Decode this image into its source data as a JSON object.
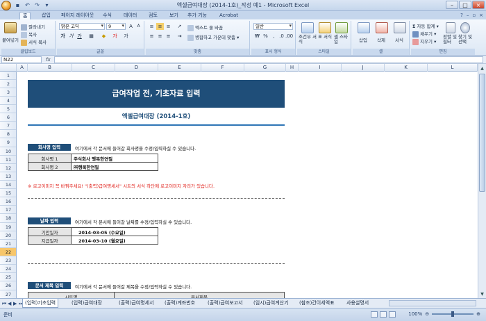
{
  "window": {
    "title": "엑셀급여대장 (2014-1호)_작성 예1 - Microsoft Excel",
    "controls": [
      "–",
      "□",
      "×"
    ]
  },
  "ribbon": {
    "tabs": [
      "홈",
      "삽입",
      "페이지 레이아웃",
      "수식",
      "데이터",
      "검토",
      "보기",
      "추가 기능",
      "Acrobat"
    ],
    "clipboard": {
      "paste": "붙여넣기",
      "cut": "잘라내기",
      "copy": "복사",
      "format_painter": "서식 복사",
      "label": "클립보드"
    },
    "font": {
      "name": "맑은 고딕",
      "size": "9",
      "label": "글꼴"
    },
    "alignment": {
      "wrap": "텍스트 줄 바꿈",
      "merge": "병합하고 가운데 맞춤",
      "label": "맞춤"
    },
    "number": {
      "format": "일반",
      "label": "표시 형식"
    },
    "styles": {
      "conditional": "조건부 서식",
      "table": "표 서식",
      "cell": "셀 스타일",
      "label": "스타일"
    },
    "cells": {
      "insert": "삽입",
      "delete": "삭제",
      "format": "서식",
      "label": "셀"
    },
    "editing": {
      "autosum": "자동 합계",
      "fill": "채우기",
      "clear": "지우기",
      "sort": "정렬 및 필터",
      "find": "찾기 및 선택",
      "label": "편집"
    }
  },
  "formula_bar": {
    "name_box": "N22",
    "fx": "fx",
    "content": ""
  },
  "columns": [
    "A",
    "B",
    "C",
    "D",
    "E",
    "F",
    "G",
    "H",
    "I",
    "J",
    "K",
    "L"
  ],
  "rows": [
    "1",
    "2",
    "3",
    "4",
    "5",
    "6",
    "7",
    "8",
    "9",
    "10",
    "11",
    "12",
    "13",
    "14",
    "15",
    "16",
    "17",
    "18",
    "19",
    "20",
    "21",
    "22",
    "23",
    "24",
    "25",
    "26",
    "27"
  ],
  "selected_row": "22",
  "sheet": {
    "banner": "급여작업 전, 기초자료 입력",
    "subtitle": "엑셀급여대장 (2014-1호)",
    "company": {
      "label": "회사명 입력",
      "note": "여기에서 각 문서에 들어갈 회사명을 수정/입력하실 수 있습니다.",
      "rows": [
        {
          "label": "회사명 1",
          "value": "주식회사 행복한연필"
        },
        {
          "label": "회사명 2",
          "value": "㈜행복한연필"
        }
      ]
    },
    "warning": "※ 로고이미지 꼭 바꿔주세요! \"(출력)급여명세서\" 시트의 서식 하단에 로고이미지 자리가 있습니다.",
    "date": {
      "label": "날짜 입력",
      "note": "여기에서 각 문서에 들어갈 날짜를 수정/입력하실 수 있습니다.",
      "rows": [
        {
          "label": "기안일자",
          "value": "2014-03-05 (수요일)"
        },
        {
          "label": "지급일자",
          "value": "2014-03-10 (월요일)"
        }
      ]
    },
    "doc_title": {
      "label": "문서 제목 입력",
      "note": "여기에서 각 문서에 들어갈 제목을 수정/입력하실 수 있습니다.",
      "headers": [
        "시트명",
        "문서제목"
      ]
    }
  },
  "sheet_tabs": [
    "(입력)기초입력",
    "(입력)급여대장",
    "(출력)급여명세서",
    "(출력)계좌번호",
    "(출력)급여보고서",
    "(임시)급여계산기",
    "(참조)간이세액표",
    "사용설명서"
  ],
  "active_sheet": "(입력)기초입력",
  "status": {
    "mode": "준비",
    "zoom": "100%"
  }
}
